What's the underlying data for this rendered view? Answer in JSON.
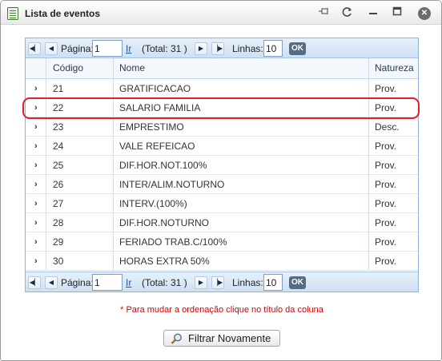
{
  "window": {
    "title": "Lista de eventos",
    "controls": [
      "pin-icon",
      "refresh-icon",
      "minimize-icon",
      "maximize-icon",
      "close-icon"
    ]
  },
  "pager": {
    "page_label": "Página:",
    "page_value": "1",
    "go_label": "Ir",
    "total_label": "(Total: 31 )",
    "lines_label": "Linhas:",
    "lines_value": "10",
    "ok_label": "OK"
  },
  "table": {
    "columns": [
      "Código",
      "Nome",
      "Natureza"
    ],
    "rows": [
      {
        "codigo": "21",
        "nome": "GRATIFICACAO",
        "natureza": "Prov."
      },
      {
        "codigo": "22",
        "nome": "SALARIO FAMILIA",
        "natureza": "Prov."
      },
      {
        "codigo": "23",
        "nome": "EMPRESTIMO",
        "natureza": "Desc."
      },
      {
        "codigo": "24",
        "nome": "VALE REFEICAO",
        "natureza": "Prov."
      },
      {
        "codigo": "25",
        "nome": "DIF.HOR.NOT.100%",
        "natureza": "Prov."
      },
      {
        "codigo": "26",
        "nome": "INTER/ALIM.NOTURNO",
        "natureza": "Prov."
      },
      {
        "codigo": "27",
        "nome": "INTERV.(100%)",
        "natureza": "Prov."
      },
      {
        "codigo": "28",
        "nome": "DIF.HOR.NOTURNO",
        "natureza": "Prov."
      },
      {
        "codigo": "29",
        "nome": "FERIADO TRAB.C/100%",
        "natureza": "Prov."
      },
      {
        "codigo": "30",
        "nome": "HORAS EXTRA 50%",
        "natureza": "Prov."
      }
    ],
    "highlighted_row": "22"
  },
  "note": "* Para mudar a ordenação clique no título da coluna",
  "filter_button": "Filtrar Novamente",
  "colors": {
    "highlight": "#e01f26",
    "note": "#d60000",
    "grid_border": "#8fb3d6"
  }
}
